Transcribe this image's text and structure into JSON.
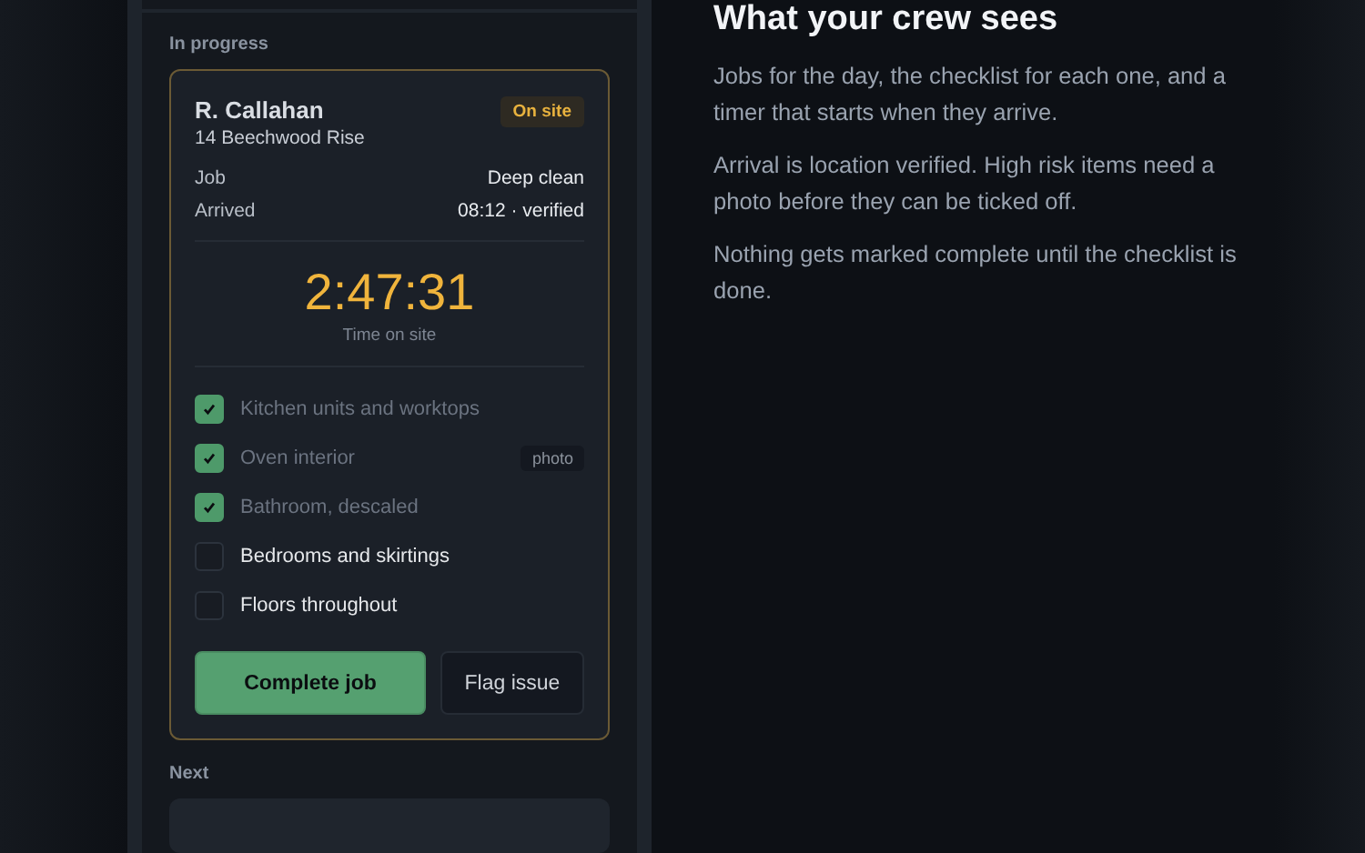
{
  "current_job": {
    "section_label": "In progress",
    "client": "R. Callahan",
    "address": "14 Beechwood Rise",
    "status": "On site",
    "details": [
      {
        "label": "Job",
        "value": "Deep clean"
      },
      {
        "label": "Arrived",
        "value": "08:12 · verified"
      }
    ],
    "timer": {
      "value": "2:47:31",
      "caption": "Time on site"
    },
    "checklist": [
      {
        "label": "Kitchen units and worktops",
        "checked": true
      },
      {
        "label": "Oven interior",
        "checked": true,
        "tag": "photo"
      },
      {
        "label": "Bathroom, descaled",
        "checked": true
      },
      {
        "label": "Bedrooms and skirtings",
        "checked": false
      },
      {
        "label": "Floors throughout",
        "checked": false
      }
    ],
    "actions": [
      {
        "label": "Complete job",
        "kind": "primary"
      },
      {
        "label": "Flag issue",
        "kind": "secondary"
      }
    ]
  },
  "next_section": {
    "label": "Next"
  },
  "explainer": {
    "title": "What your crew sees",
    "paragraphs": [
      "Jobs for the day, the checklist for each one, and a timer that starts when they arrive.",
      "Arrival is location verified. High risk items need a photo before they can be ticked off.",
      "Nothing gets marked complete until the checklist is done."
    ]
  }
}
